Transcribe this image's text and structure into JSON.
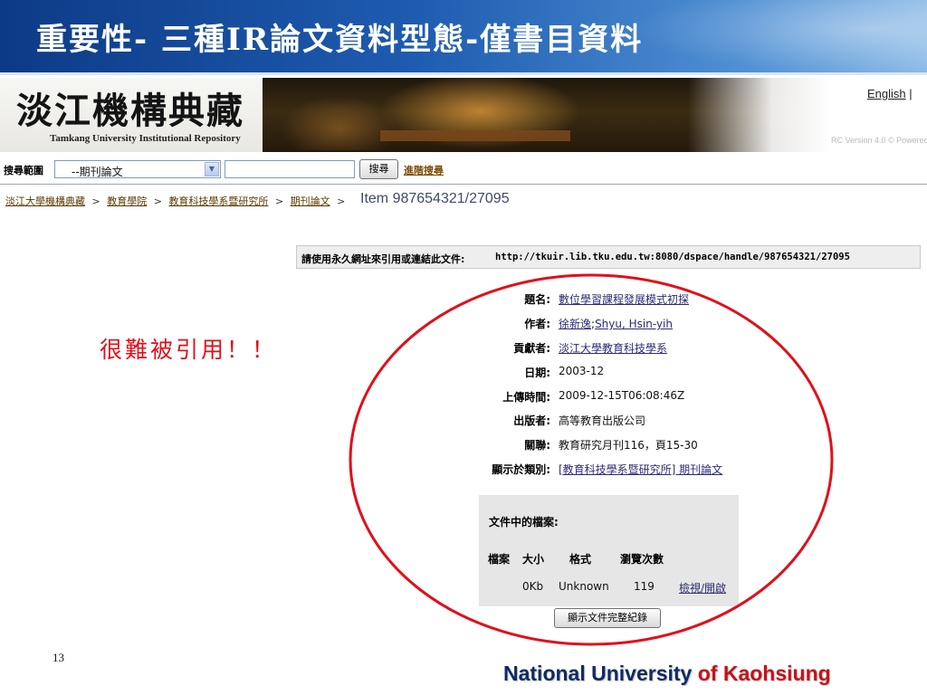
{
  "slide": {
    "title": "重要性- 三種IR論文資料型態-僅書目資料",
    "page_number": "13",
    "annotation": "很難被引用！！",
    "footer_main": "National University ",
    "footer_accent": "of Kaohsiung",
    "colors": {
      "annotation": "#e0101a",
      "title_bg": "#1e5cb0",
      "footer": "#0e2a66",
      "footer_accent": "#c8101a"
    }
  },
  "banner": {
    "logo_text": "淡江機構典藏",
    "logo_subtitle": "Tamkang University Institutional Repository",
    "lang_link": "English",
    "lang_sep": "|",
    "version": "RC Version 4.0 © Powered"
  },
  "search": {
    "label": "搜尋範圍",
    "scope_value": "--期刊論文",
    "query_value": "",
    "button_label": "搜尋",
    "advanced_label": "進階搜尋"
  },
  "breadcrumb": {
    "items": [
      "淡江大學機構典藏",
      "教育學院",
      "教育科技學系暨研究所",
      "期刊論文"
    ],
    "separator": ">",
    "item_id": "Item 987654321/27095"
  },
  "permalink": {
    "label": "請使用永久網址來引用或連結此文件:",
    "url": "http://tkuir.lib.tku.edu.tw:8080/dspace/handle/987654321/27095"
  },
  "metadata": {
    "title_label": "題名:",
    "title_value": "數位學習課程發展模式初探",
    "author_label": "作者:",
    "author_1": "徐新逸",
    "author_sep": ";",
    "author_2": "Shyu, Hsin-yih",
    "contributor_label": "貢獻者:",
    "contributor_value": "淡江大學教育科技學系",
    "date_label": "日期:",
    "date_value": "2003-12",
    "upload_label": "上傳時間:",
    "upload_value": "2009-12-15T06:08:46Z",
    "publisher_label": "出版者:",
    "publisher_value": "高等教育出版公司",
    "relation_label": "關聯:",
    "relation_value": "教育研究月刊116，頁15-30",
    "collection_label": "顯示於類別:",
    "collection_value": "[教育科技學系暨研究所] 期刊論文"
  },
  "files": {
    "title": "文件中的檔案:",
    "headers": [
      "檔案",
      "大小",
      "格式",
      "瀏覽次數"
    ],
    "row": {
      "file": "",
      "size": "0Kb",
      "format": "Unknown",
      "views": "119",
      "action": "檢視/開啟"
    },
    "full_record_button": "顯示文件完整紀錄"
  }
}
